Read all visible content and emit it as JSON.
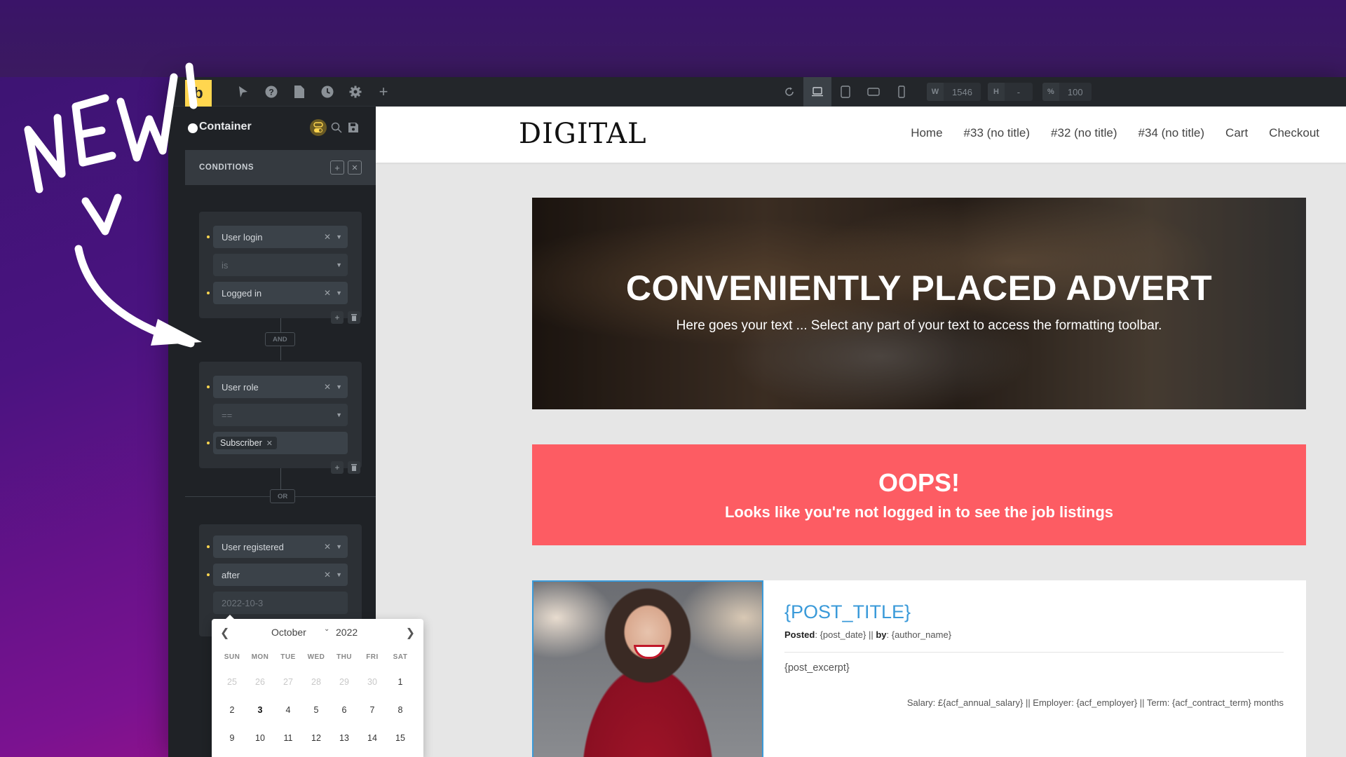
{
  "overlay": {
    "annotation_text": "NEW!"
  },
  "toolbar": {
    "logo": "b",
    "icons": [
      "select-cursor-icon",
      "help-icon",
      "page-icon",
      "history-icon",
      "settings-icon",
      "add-icon"
    ],
    "device_icons": [
      "refresh-icon",
      "desktop-icon",
      "tablet-portrait-icon",
      "tablet-landscape-icon",
      "mobile-icon"
    ],
    "active_device": "desktop",
    "width_label": "W",
    "width_value": "1546",
    "height_label": "H",
    "height_value": "-",
    "zoom_label": "%",
    "zoom_value": "100"
  },
  "panel": {
    "element_title": "Container",
    "conditions_label": "CONDITIONS",
    "groups": [
      {
        "fields": [
          {
            "value": "User login",
            "clearable": true,
            "bullet": true
          },
          {
            "value": "is",
            "placeholder": true
          },
          {
            "value": "Logged in",
            "clearable": true,
            "bullet": true
          }
        ]
      },
      {
        "fields": [
          {
            "value": "User role",
            "clearable": true,
            "bullet": true
          },
          {
            "value": "==",
            "placeholder": true
          },
          {
            "tag": "Subscriber",
            "bullet": true
          }
        ]
      },
      {
        "fields": [
          {
            "value": "User registered",
            "clearable": true,
            "bullet": true
          },
          {
            "value": "after",
            "clearable": true,
            "bullet": true
          },
          {
            "value": "2022-10-3",
            "placeholder": true
          }
        ]
      }
    ],
    "connectors": [
      "AND",
      "OR"
    ]
  },
  "datepicker": {
    "month": "October",
    "year": "2022",
    "weekdays": [
      "SUN",
      "MON",
      "TUE",
      "WED",
      "THU",
      "FRI",
      "SAT"
    ],
    "rows": [
      [
        {
          "d": "25",
          "muted": true
        },
        {
          "d": "26",
          "muted": true
        },
        {
          "d": "27",
          "muted": true
        },
        {
          "d": "28",
          "muted": true
        },
        {
          "d": "29",
          "muted": true
        },
        {
          "d": "30",
          "muted": true
        },
        {
          "d": "1"
        }
      ],
      [
        {
          "d": "2"
        },
        {
          "d": "3",
          "today": true
        },
        {
          "d": "4"
        },
        {
          "d": "5"
        },
        {
          "d": "6"
        },
        {
          "d": "7"
        },
        {
          "d": "8"
        }
      ],
      [
        {
          "d": "9"
        },
        {
          "d": "10"
        },
        {
          "d": "11"
        },
        {
          "d": "12"
        },
        {
          "d": "13"
        },
        {
          "d": "14"
        },
        {
          "d": "15"
        }
      ]
    ]
  },
  "site": {
    "brand": "DIGITAL",
    "nav": [
      "Home",
      "#33 (no title)",
      "#32 (no title)",
      "#34 (no title)",
      "Cart",
      "Checkout"
    ],
    "hero": {
      "title": "CONVENIENTLY PLACED ADVERT",
      "subtitle": "Here goes your text ... Select any part of your text to access the formatting toolbar."
    },
    "alert": {
      "title": "OOPS!",
      "message": "Looks like you're not logged in to see the job listings",
      "color": "#fd5c63"
    },
    "post": {
      "title": "{POST_TITLE}",
      "posted_label": "Posted",
      "posted_value": ": {post_date} || ",
      "by_label": "by",
      "by_value": ": {author_name}",
      "excerpt": "{post_excerpt}",
      "salary_line": "Salary: £{acf_annual_salary} || Employer: {acf_employer} || Term: {acf_contract_term} months",
      "title_color": "#3a9ad9"
    }
  },
  "colors": {
    "accent": "#ffd64f",
    "panel_bg": "#1f2226"
  }
}
